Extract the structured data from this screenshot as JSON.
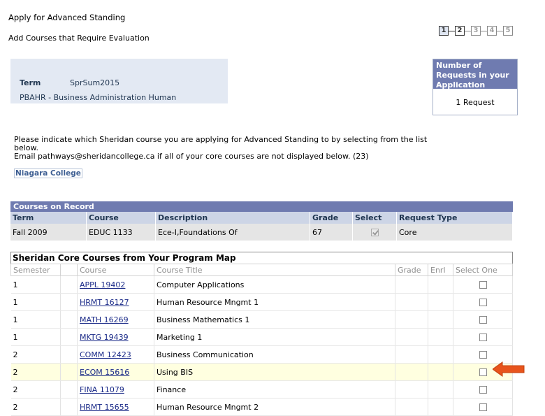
{
  "page": {
    "title": "Apply for Advanced Standing",
    "subtitle": "Add Courses that Require Evaluation"
  },
  "steps": [
    "1",
    "2",
    "3",
    "4",
    "5"
  ],
  "term": {
    "label": "Term",
    "value": "SprSum2015",
    "program": "PBAHR - Business Administration Human"
  },
  "requests": {
    "header": "Number of Requests in your Application",
    "value": "1 Request"
  },
  "instructions": {
    "line1": "Please indicate which Sheridan course you are applying for Advanced Standing to by selecting from the list below.",
    "line2": "Email pathways@sheridancollege.ca if all of your core courses are not displayed below. (23)"
  },
  "college_link": "Niagara College",
  "courses_on_record": {
    "caption": "Courses on Record",
    "headers": {
      "term": "Term",
      "course": "Course",
      "description": "Description",
      "grade": "Grade",
      "select": "Select",
      "request_type": "Request Type"
    },
    "rows": [
      {
        "term": "Fall 2009",
        "course": "EDUC 1133",
        "description": "Ece-I,Foundations Of",
        "grade": "67",
        "selected": true,
        "request_type": "Core"
      }
    ]
  },
  "core_courses": {
    "caption": "Sheridan Core Courses from Your Program Map",
    "headers": {
      "semester": "Semester",
      "course": "Course",
      "course_title": "Course Title",
      "grade": "Grade",
      "enrl": "Enrl",
      "select_one": "Select One"
    },
    "rows": [
      {
        "semester": "1",
        "course": "APPL 19402",
        "title": "Computer Applications"
      },
      {
        "semester": "1",
        "course": "HRMT 16127",
        "title": "Human Resource Mngmt 1"
      },
      {
        "semester": "1",
        "course": "MATH 16269",
        "title": "Business Mathematics 1"
      },
      {
        "semester": "1",
        "course": "MKTG 19439",
        "title": "Marketing 1"
      },
      {
        "semester": "2",
        "course": "COMM 12423",
        "title": "Business Communication"
      },
      {
        "semester": "2",
        "course": "ECOM 15616",
        "title": "Using BIS"
      },
      {
        "semester": "2",
        "course": "FINA 11079",
        "title": "Finance"
      },
      {
        "semester": "2",
        "course": "HRMT 15655",
        "title": "Human Resource Mngmt 2"
      }
    ]
  },
  "colors": {
    "header_blue": "#6f7bb0",
    "column_header": "#cdd5e6",
    "highlight_row": "#ffffe0",
    "arrow": "#e8541c"
  }
}
